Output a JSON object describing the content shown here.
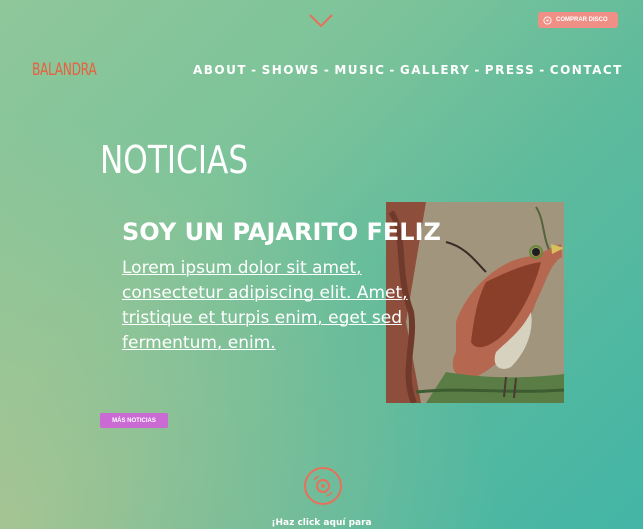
{
  "header": {
    "buy_button_label": "COMPRAR DISCO",
    "logo": "BALANDRA",
    "nav": [
      "ABOUT",
      "SHOWS",
      "MUSIC",
      "GALLERY",
      "PRESS",
      "CONTACT"
    ],
    "nav_separator": "-"
  },
  "news": {
    "section_title": "NOTICIAS",
    "post": {
      "title": "SOY UN PAJARITO FELIZ",
      "excerpt": "Lorem ipsum dolor sit amet, consectetur adipiscing elit. Amet, tristique et turpis enim, eget sed fermentum, enim."
    },
    "more_button_label": "MÁS NOTICIAS"
  },
  "footer": {
    "disc_caption": "¡Haz click aquí para"
  },
  "icons": {
    "scroll": "chevron-down-icon",
    "buy": "disc-icon",
    "footer": "vinyl-disc-icon"
  },
  "colors": {
    "logo": "#e8603f",
    "buy_button": "#f08f86",
    "more_button": "#c96bd3",
    "disc_icon": "#e8705a"
  }
}
